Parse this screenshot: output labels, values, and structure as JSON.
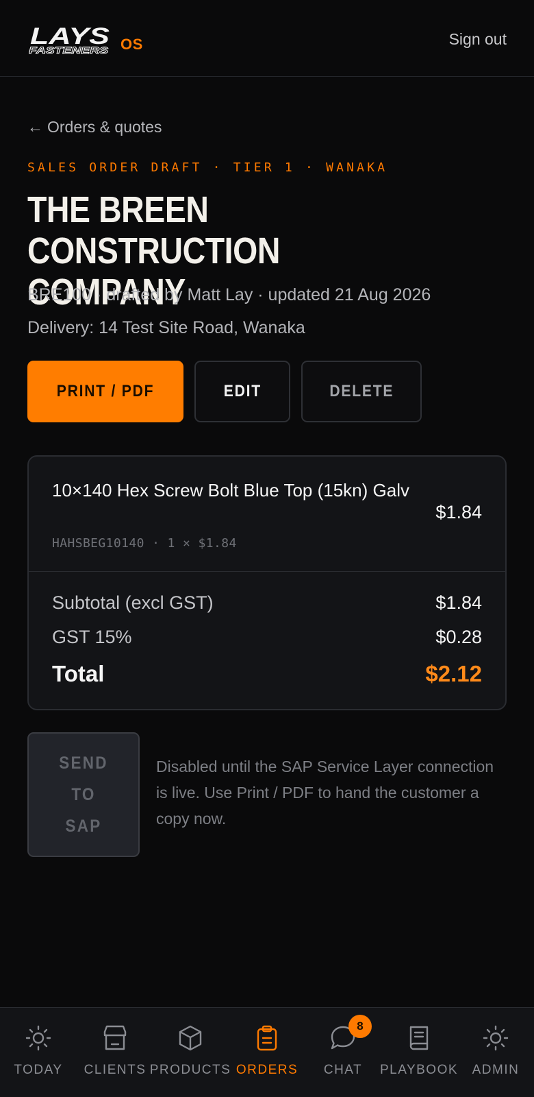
{
  "header": {
    "logo_word": "LAYS",
    "logo_sub": "FASTENERS",
    "logo_suffix": "OS",
    "sign_out": "Sign out"
  },
  "back": {
    "arrow": "←",
    "label": "Orders & quotes"
  },
  "order": {
    "eyebrow": "SALES ORDER DRAFT · TIER 1 · WANAKA",
    "title": "THE BREEN CONSTRUCTION COMPANY",
    "meta": "BRE100 · drafted by Matt Lay · updated 21 Aug 2026",
    "delivery": "Delivery: 14 Test Site Road, Wanaka"
  },
  "actions": {
    "print": "PRINT / PDF",
    "edit": "EDIT",
    "delete": "DELETE"
  },
  "line_item": {
    "name": "10×140 Hex Screw Bolt Blue Top (15kn) Galv",
    "sku_line": "HAHSBEG10140 · 1 × $1.84",
    "price": "$1.84"
  },
  "totals": {
    "subtotal_label": "Subtotal (excl GST)",
    "subtotal_value": "$1.84",
    "gst_label": "GST 15%",
    "gst_value": "$0.28",
    "total_label": "Total",
    "total_value": "$2.12"
  },
  "sap": {
    "button": "SEND TO SAP",
    "note": "Disabled until the SAP Service Layer connection is live. Use Print / PDF to hand the customer a copy now."
  },
  "nav": {
    "items": [
      {
        "label": "TODAY",
        "icon": "sun-icon"
      },
      {
        "label": "CLIENTS",
        "icon": "store-icon"
      },
      {
        "label": "PRODUCTS",
        "icon": "box-icon"
      },
      {
        "label": "ORDERS",
        "icon": "clipboard-icon",
        "active": true
      },
      {
        "label": "CHAT",
        "icon": "chat-icon",
        "badge": "8"
      },
      {
        "label": "PLAYBOOK",
        "icon": "book-icon"
      },
      {
        "label": "ADMIN",
        "icon": "gear-icon"
      }
    ]
  },
  "colors": {
    "accent": "#ff7a00",
    "background": "#0a0a0b",
    "card": "#131417"
  }
}
